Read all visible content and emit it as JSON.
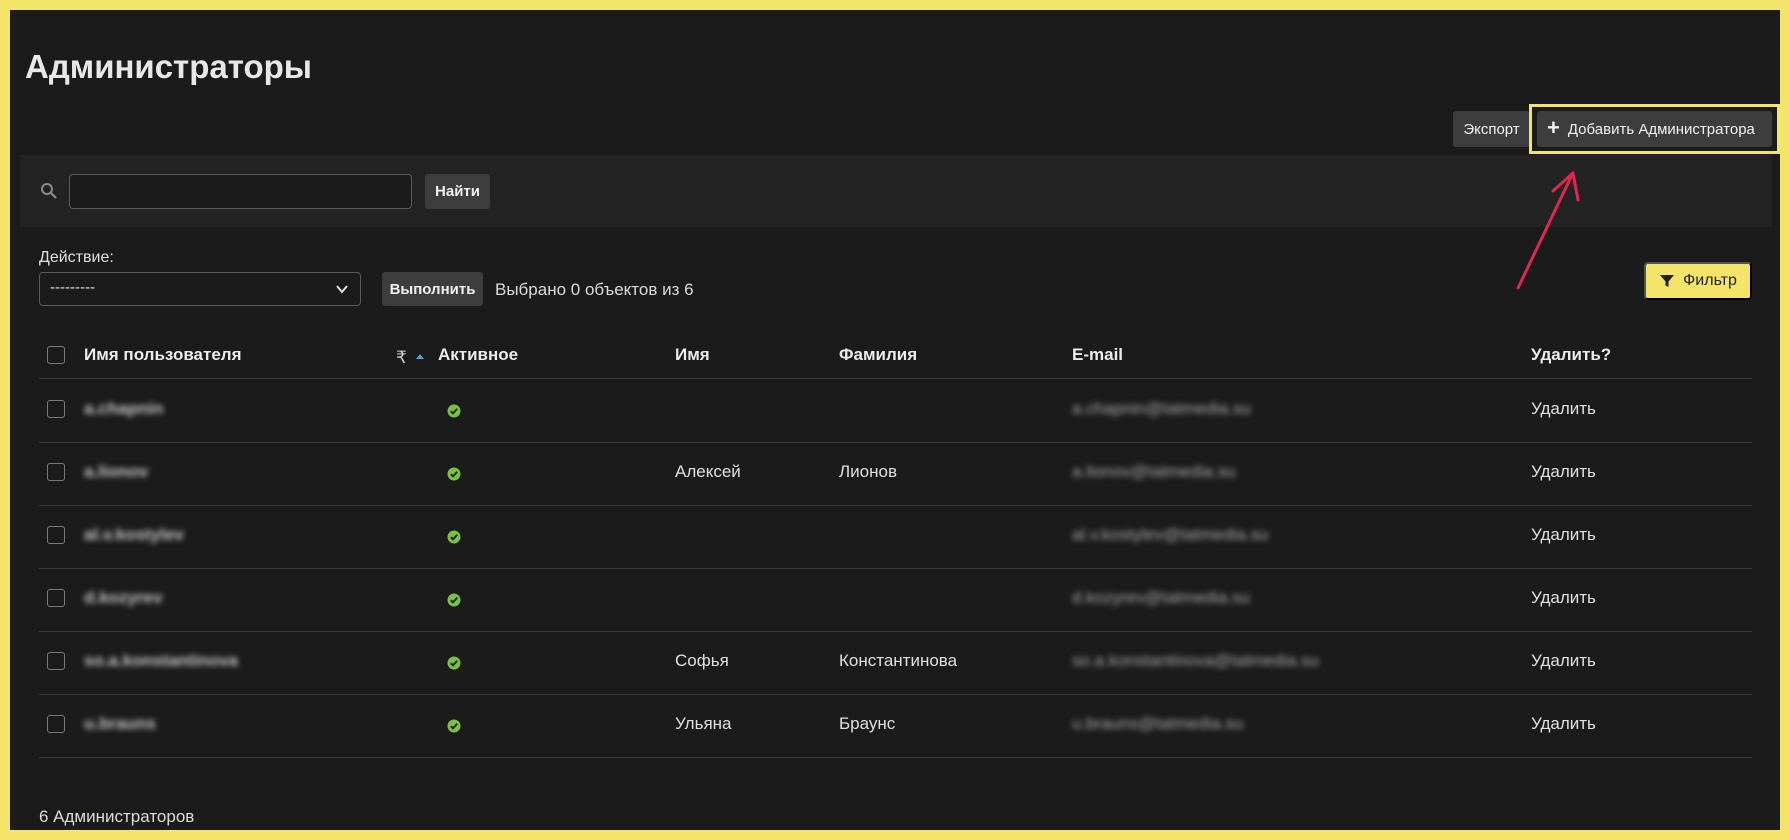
{
  "page": {
    "title": "Администраторы"
  },
  "toolbar": {
    "export_label": "Экспорт",
    "add_label": "Добавить Администратора"
  },
  "search": {
    "value": "",
    "placeholder": "",
    "button_label": "Найти"
  },
  "actions": {
    "label": "Действие:",
    "selected_value": "---------",
    "run_label": "Выполнить",
    "selected_count_text": "Выбрано 0 объектов из 6"
  },
  "filter": {
    "label": "Фильтр"
  },
  "table": {
    "columns": [
      "Имя пользователя",
      "Активное",
      "Имя",
      "Фамилия",
      "E-mail",
      "Удалить?"
    ],
    "rows": [
      {
        "username": "a.chapnin",
        "active": true,
        "first_name": "",
        "last_name": "",
        "email": "a.chapnin@tatmedia.su",
        "delete_label": "Удалить"
      },
      {
        "username": "a.lionov",
        "active": true,
        "first_name": "Алексей",
        "last_name": "Лионов",
        "email": "a.lionov@tatmedia.su",
        "delete_label": "Удалить"
      },
      {
        "username": "al.v.kostylev",
        "active": true,
        "first_name": "",
        "last_name": "",
        "email": "al.v.kostylev@tatmedia.su",
        "delete_label": "Удалить"
      },
      {
        "username": "d.kozyrev",
        "active": true,
        "first_name": "",
        "last_name": "",
        "email": "d.kozyrev@tatmedia.su",
        "delete_label": "Удалить"
      },
      {
        "username": "so.a.konstantinova",
        "active": true,
        "first_name": "Софья",
        "last_name": "Константинова",
        "email": "so.a.konstantinova@tatmedia.su",
        "delete_label": "Удалить"
      },
      {
        "username": "u.brauns",
        "active": true,
        "first_name": "Ульяна",
        "last_name": "Браунс",
        "email": "u.brauns@tatmedia.su",
        "delete_label": "Удалить"
      }
    ]
  },
  "footer": {
    "count_text": "6 Администраторов"
  },
  "colors": {
    "background": "#1b1b1b",
    "frame_highlight": "#f5e46a",
    "accent_arrow": "#e0284f",
    "active_check": "#7ac143"
  },
  "icons": {
    "search": "search-icon",
    "plus": "plus-icon",
    "filter": "funnel-icon",
    "chevron": "chevron-down-icon",
    "active": "check-circle-icon",
    "sort": "sort-icon"
  }
}
